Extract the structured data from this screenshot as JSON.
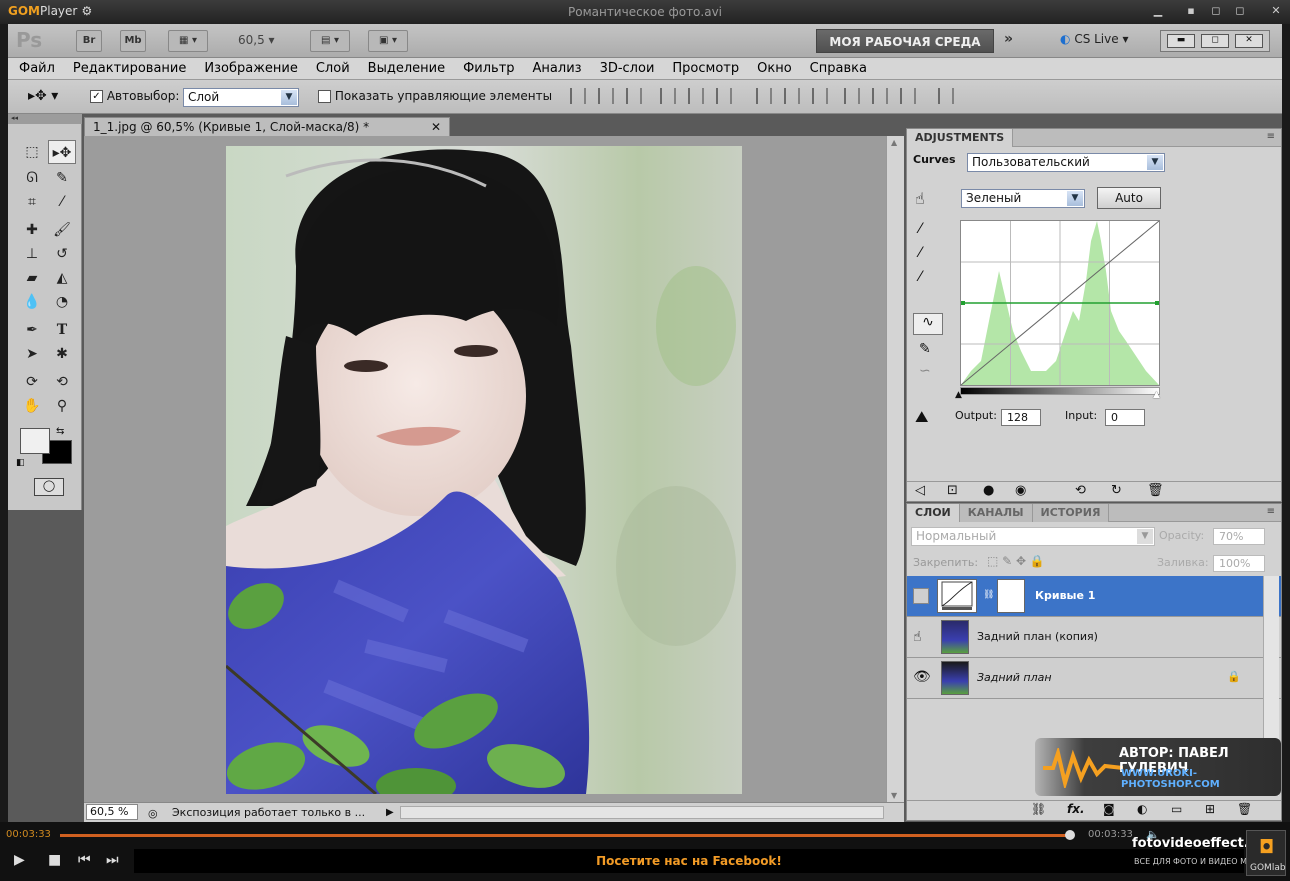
{
  "player": {
    "logo_gom": "GOM",
    "logo_player": "Player",
    "file_title": "Романтическое фото.avi",
    "time_elapsed": "00:03:33",
    "time_total": "00:03:33",
    "banner": "Посетите нас на Facebook!",
    "brand": "fotovideoeffect.com",
    "brand_tagline": "ВСЕ ДЛЯ ФОТО И ВИДЕО МОНТАЖА!",
    "gomlab": "GOMlab",
    "progress": 1.0
  },
  "appbar": {
    "ps": "Ps",
    "br": "Br",
    "mb": "Mb",
    "zoom": "60,5",
    "workspace": "МОЯ РАБОЧАЯ СРЕДА",
    "cslive": "CS Live"
  },
  "menu": [
    "Файл",
    "Редактирование",
    "Изображение",
    "Слой",
    "Выделение",
    "Фильтр",
    "Анализ",
    "3D-слои",
    "Просмотр",
    "Окно",
    "Справка"
  ],
  "options": {
    "autoselect_label": "Автовыбор:",
    "autoselect_value": "Слой",
    "show_controls_label": "Показать управляющие элементы"
  },
  "document": {
    "tab_title": "1_1.jpg @ 60,5% (Кривые 1, Слой-маска/8) *",
    "zoom_status": "60,5 %",
    "status_text": "Экспозиция работает только в ..."
  },
  "adjustments": {
    "tab": "ADJUSTMENTS",
    "curves_label": "Curves",
    "preset": "Пользовательский",
    "channel": "Зеленый",
    "auto_label": "Auto",
    "output_label": "Output:",
    "output_value": "128",
    "input_label": "Input:",
    "input_value": "0"
  },
  "layers": {
    "tabs": [
      "СЛОИ",
      "КАНАЛЫ",
      "ИСТОРИЯ"
    ],
    "blend_mode": "Нормальный",
    "opacity_label": "Opacity:",
    "opacity_value": "70%",
    "lock_label": "Закрепить:",
    "fill_label": "Заливка:",
    "fill_value": "100%",
    "items": [
      {
        "name": "Кривые 1"
      },
      {
        "name": "Задний план (копия)"
      },
      {
        "name": "Задний план"
      }
    ]
  },
  "watermark": {
    "author": "АВТОР: ПАВЕЛ ГУЛЕВИЧ",
    "site": "WWW.UROKI-PHOTOSHOP.COM"
  },
  "colors": {
    "accent_orange": "#f29b26",
    "selected_layer": "#3c74c8",
    "histogram_green": "#b4e6a8"
  }
}
